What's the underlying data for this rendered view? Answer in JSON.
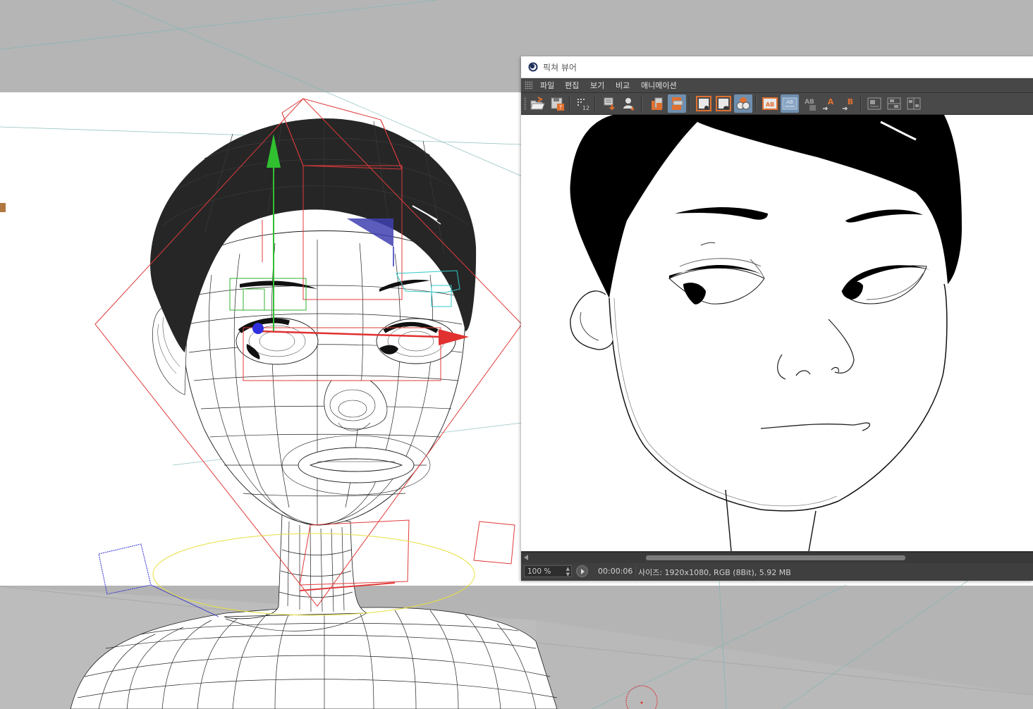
{
  "window": {
    "title": "픽쳐 뷰어",
    "icon": "cinema4d-logo-icon"
  },
  "menu": {
    "items": [
      "파일",
      "편집",
      "보기",
      "비교",
      "애니메이션"
    ]
  },
  "toolbar": {
    "buttons": [
      {
        "name": "open-image-icon",
        "active": false
      },
      {
        "name": "save-image-icon",
        "active": false
      },
      {
        "name": "filter-grid-icon",
        "active": false
      },
      {
        "name": "export-down-icon",
        "active": false
      },
      {
        "name": "user-render-icon",
        "active": false
      },
      {
        "name": "copy-orange-icon",
        "active": false
      },
      {
        "name": "stack-orange-icon",
        "active": true
      },
      {
        "name": "view-single-icon",
        "active": false
      },
      {
        "name": "view-eye-icon",
        "active": false
      },
      {
        "name": "view-compare-icon",
        "active": true
      },
      {
        "name": "ab-compare-icon",
        "label": "AB",
        "active": false
      },
      {
        "name": "ab-split-icon",
        "label": "AB",
        "active": true
      },
      {
        "name": "ab-overlay-icon",
        "label": "AB",
        "active": false
      },
      {
        "name": "set-a-icon",
        "label": "A",
        "active": false
      },
      {
        "name": "set-b-icon",
        "label": "B",
        "active": false
      },
      {
        "name": "ab-layout-1-icon",
        "active": false
      },
      {
        "name": "ab-layout-2-icon",
        "active": false
      },
      {
        "name": "ab-layout-3-icon",
        "active": false
      }
    ]
  },
  "status": {
    "zoom": "100 %",
    "time": "00:00:06",
    "info": "사이즈: 1920x1080, RGB (8Bit), 5.92 MB"
  },
  "colors": {
    "accent_active": "#6f8fb0",
    "axis_x": "#e03030",
    "axis_y": "#30c030",
    "axis_z": "#3030e0"
  }
}
